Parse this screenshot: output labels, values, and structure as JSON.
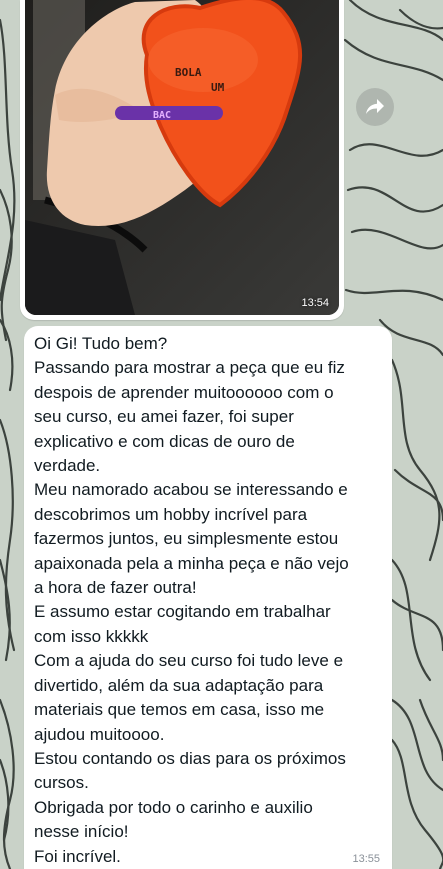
{
  "colors": {
    "wallpaper": "#c9d2c8",
    "wallpaper_lines": "#3c433e",
    "bubble": "#ffffff",
    "text": "#111b21",
    "timestamp": "#8a9199",
    "dish": "#f2511b",
    "skin": "#eec9ad"
  },
  "photo_message": {
    "dish_text_lines": [
      "BOLA",
      "UM",
      "BAC"
    ],
    "time": "13:54"
  },
  "forward_button": {
    "icon": "forward-arrow-icon"
  },
  "text_message": {
    "lines": [
      "Oi Gi! Tudo bem?",
      "Passando para mostrar a peça que eu fiz",
      "despois de aprender muitoooooo com o",
      "seu curso, eu amei fazer, foi super",
      "explicativo e com dicas de ouro de",
      "verdade.",
      "Meu namorado acabou se interessando e",
      "descobrimos um hobby incrível para",
      "fazermos juntos, eu simplesmente estou",
      "apaixonada pela a minha peça e não vejo",
      "a hora de fazer outra!",
      "E assumo estar cogitando em trabalhar",
      "com isso kkkkk",
      "Com a ajuda do seu curso foi tudo leve e",
      "divertido, além da sua adaptação para",
      "materiais que temos em casa, isso me",
      "ajudou muitoooo.",
      "Estou contando os dias para os próximos",
      "cursos.",
      "Obrigada por todo o carinho e auxilio",
      "nesse início!",
      "Foi incrível."
    ],
    "time": "13:55"
  }
}
